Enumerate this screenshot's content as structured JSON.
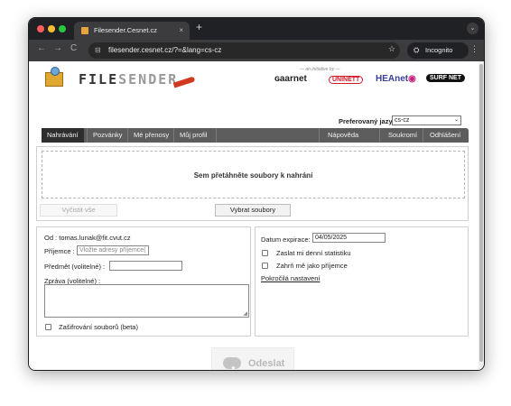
{
  "browser": {
    "tab_title": "Filesender.Cesnet.cz",
    "tab_close": "×",
    "new_tab": "+",
    "tab_menu": "⌄",
    "back": "←",
    "forward": "→",
    "reload": "C",
    "url": "filesender.cesnet.cz/?=&lang=cs-cz",
    "url_icon": "⊟",
    "star": "☆",
    "incognito_icon": "⛭",
    "incognito_label": "Incognito",
    "menu": "⋮"
  },
  "header": {
    "logo_text_bold": "FILE",
    "logo_text_light": "SENDER",
    "initiative": "— an initiative by —",
    "partners": {
      "geant": "ɢaarnet",
      "uninett": "UNINETT",
      "heanet": "HEAnet",
      "heanet_mark": "◉",
      "surfnet": "SURF NET"
    },
    "lang_label": "Preferovaný jazyk",
    "lang_value": "cs-cz",
    "lang_chevron": "⌄"
  },
  "menu": {
    "items": [
      "Nahrávání",
      "Pozvánky",
      "Mé přenosy",
      "Můj profil"
    ],
    "right_items": [
      "Nápověda",
      "Soukromí",
      "Odhlášení"
    ]
  },
  "upload": {
    "drop_text": "Sem přetáhněte soubory k nahrání",
    "clear_all": "Vyčistit vše",
    "select_files": "Vybrat soubory"
  },
  "form": {
    "from_label": "Od : tomas.lunak@fit.cvut.cz",
    "recipient_label": "Příjemce :",
    "recipient_placeholder": "Vložte adresy příjemce(",
    "subject_label": "Předmět (volitelné) :",
    "subject_value": "",
    "message_label": "Zpráva (volitelné) :",
    "message_grip": "◢",
    "encryption_label": "Zašifrování souborů (beta)",
    "expiry_label": "Datum expirace:",
    "expiry_value": "04/05/2025",
    "daily_stats_label": "Zaslat mi denní statistiku",
    "include_me_label": "Zahrň mě jako příjemce",
    "advanced_link": "Pokročilá nastavení"
  },
  "send": {
    "label": "Odeslat",
    "icon": "⬆"
  }
}
